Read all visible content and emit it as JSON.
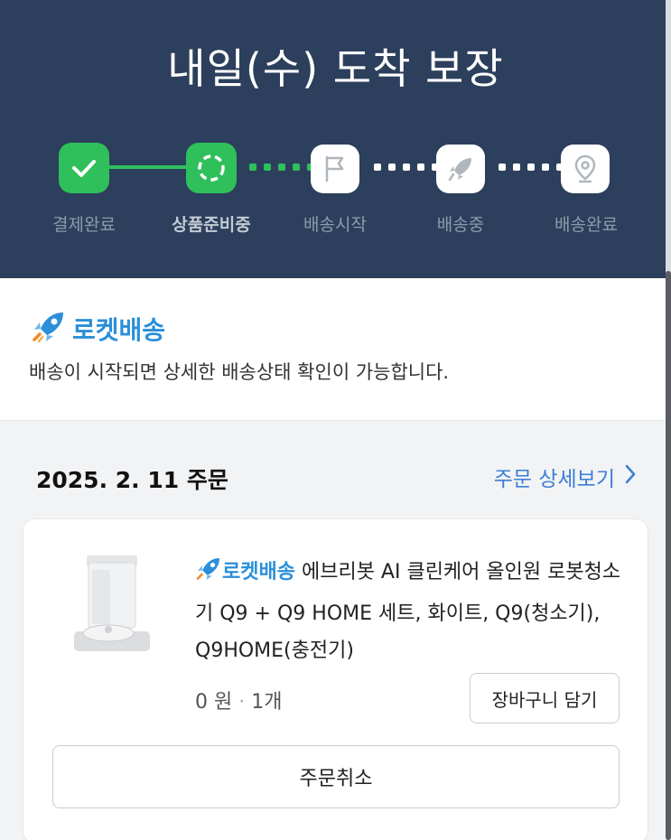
{
  "header": {
    "title": "내일(수) 도착 보장",
    "steps": [
      {
        "label": "결제완료",
        "icon": "check-icon",
        "state": "done"
      },
      {
        "label": "상품준비중",
        "icon": "loading-ring-icon",
        "state": "current"
      },
      {
        "label": "배송시작",
        "icon": "flag-icon",
        "state": "pending"
      },
      {
        "label": "배송중",
        "icon": "rocket-icon",
        "state": "pending"
      },
      {
        "label": "배송완료",
        "icon": "location-pin-icon",
        "state": "pending"
      }
    ]
  },
  "rocket": {
    "brand": "로켓배송",
    "note": "배송이 시작되면 상세한 배송상태 확인이 가능합니다."
  },
  "order": {
    "date": "2025. 2. 11 주문",
    "detail_link": "주문 상세보기",
    "product": {
      "badge": "로켓배송",
      "name": "에브리봇 AI 클린케어 올인원 로봇청소기 Q9 + Q9 HOME 세트, 화이트, Q9(청소기), Q9HOME(충전기)",
      "price": "0 원",
      "qty": "1개"
    },
    "cart_button": "장바구니 담기",
    "cancel_button": "주문취소"
  },
  "colors": {
    "header_bg": "#2c3f5c",
    "green": "#2fbf5b",
    "blue": "#2b8fd9",
    "link_blue": "#3a7fd6"
  }
}
